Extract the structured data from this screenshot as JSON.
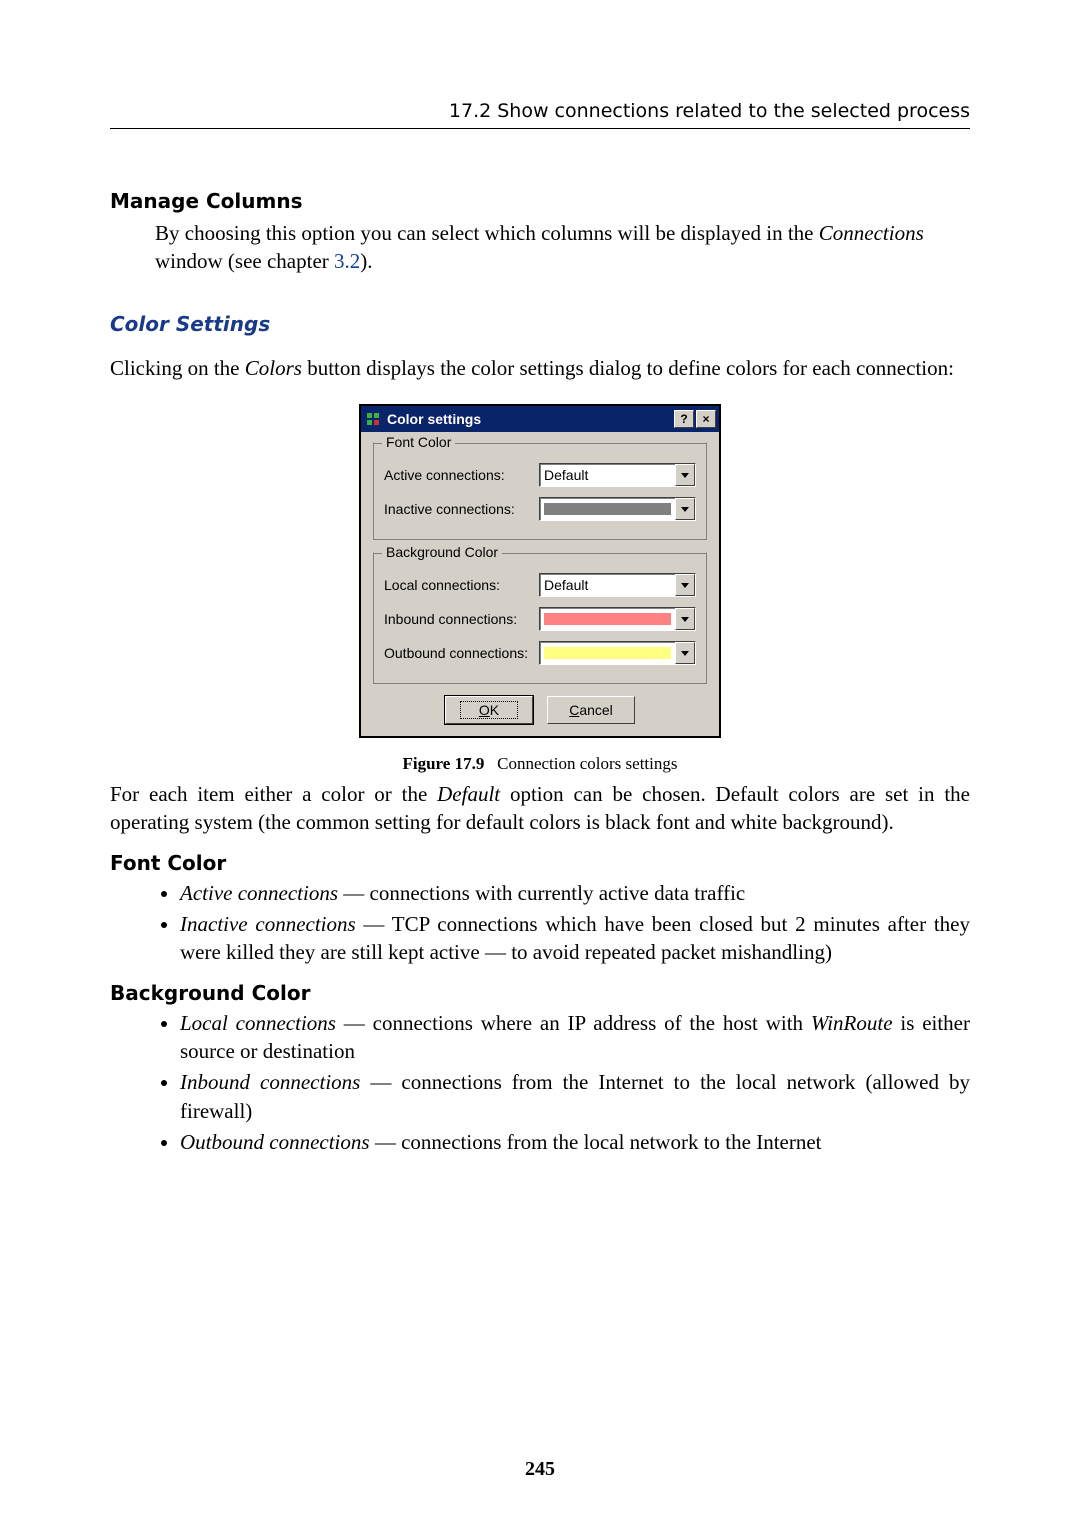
{
  "header": {
    "running": "17.2  Show connections related to the selected process"
  },
  "manage_columns": {
    "title": "Manage Columns",
    "body_pre": "By choosing this option you can select which columns will be displayed in the ",
    "body_em": "Connections",
    "body_mid": " window (see chapter ",
    "link": "3.2",
    "body_post": ")."
  },
  "color_settings": {
    "heading": "Color Settings",
    "intro_pre": "Clicking on the ",
    "intro_em": "Colors",
    "intro_post": " button displays the color settings dialog to define colors for each connection:"
  },
  "dialog": {
    "title": "Color settings",
    "help_glyph": "?",
    "close_glyph": "×",
    "font_group": "Font Color",
    "bg_group": "Background Color",
    "rows": {
      "active": {
        "label": "Active connections:",
        "value": "Default",
        "swatch": null
      },
      "inactive": {
        "label": "Inactive connections:",
        "value": "",
        "swatch": "#808080"
      },
      "local": {
        "label": "Local connections:",
        "value": "Default",
        "swatch": null
      },
      "inbound": {
        "label": "Inbound connections:",
        "value": "",
        "swatch": "#ff8080"
      },
      "outbound": {
        "label": "Outbound connections:",
        "value": "",
        "swatch": "#ffff80"
      }
    },
    "ok_u": "O",
    "ok_rest": "K",
    "cancel_u": "C",
    "cancel_rest": "ancel"
  },
  "caption": {
    "figno": "Figure 17.9",
    "text": "Connection colors settings"
  },
  "explain": {
    "pre": "For each item either a color or the ",
    "em": "Default",
    "post": " option can be chosen. Default colors are set in the operating system (the common setting for default colors is black font and white background)."
  },
  "font_color": {
    "title": "Font Color",
    "active_em": "Active connections",
    "active_txt": " — connections with currently active data traffic",
    "inactive_em": "Inactive connections",
    "inactive_txt": " — TCP connections which have been closed but 2 minutes after they were killed they are still kept active — to avoid repeated packet mishandling)"
  },
  "bg_color": {
    "title": "Background Color",
    "local_em": "Local connections",
    "local_txt_pre": " — connections where an IP address of the host with ",
    "local_txt_em": "WinRoute",
    "local_txt_post": " is either source or destination",
    "inbound_em": "Inbound connections",
    "inbound_txt": " — connections from the Internet to the local network (allowed by firewall)",
    "outbound_em": "Outbound connections",
    "outbound_txt": " — connections from the local network to the Internet"
  },
  "page_number": "245"
}
